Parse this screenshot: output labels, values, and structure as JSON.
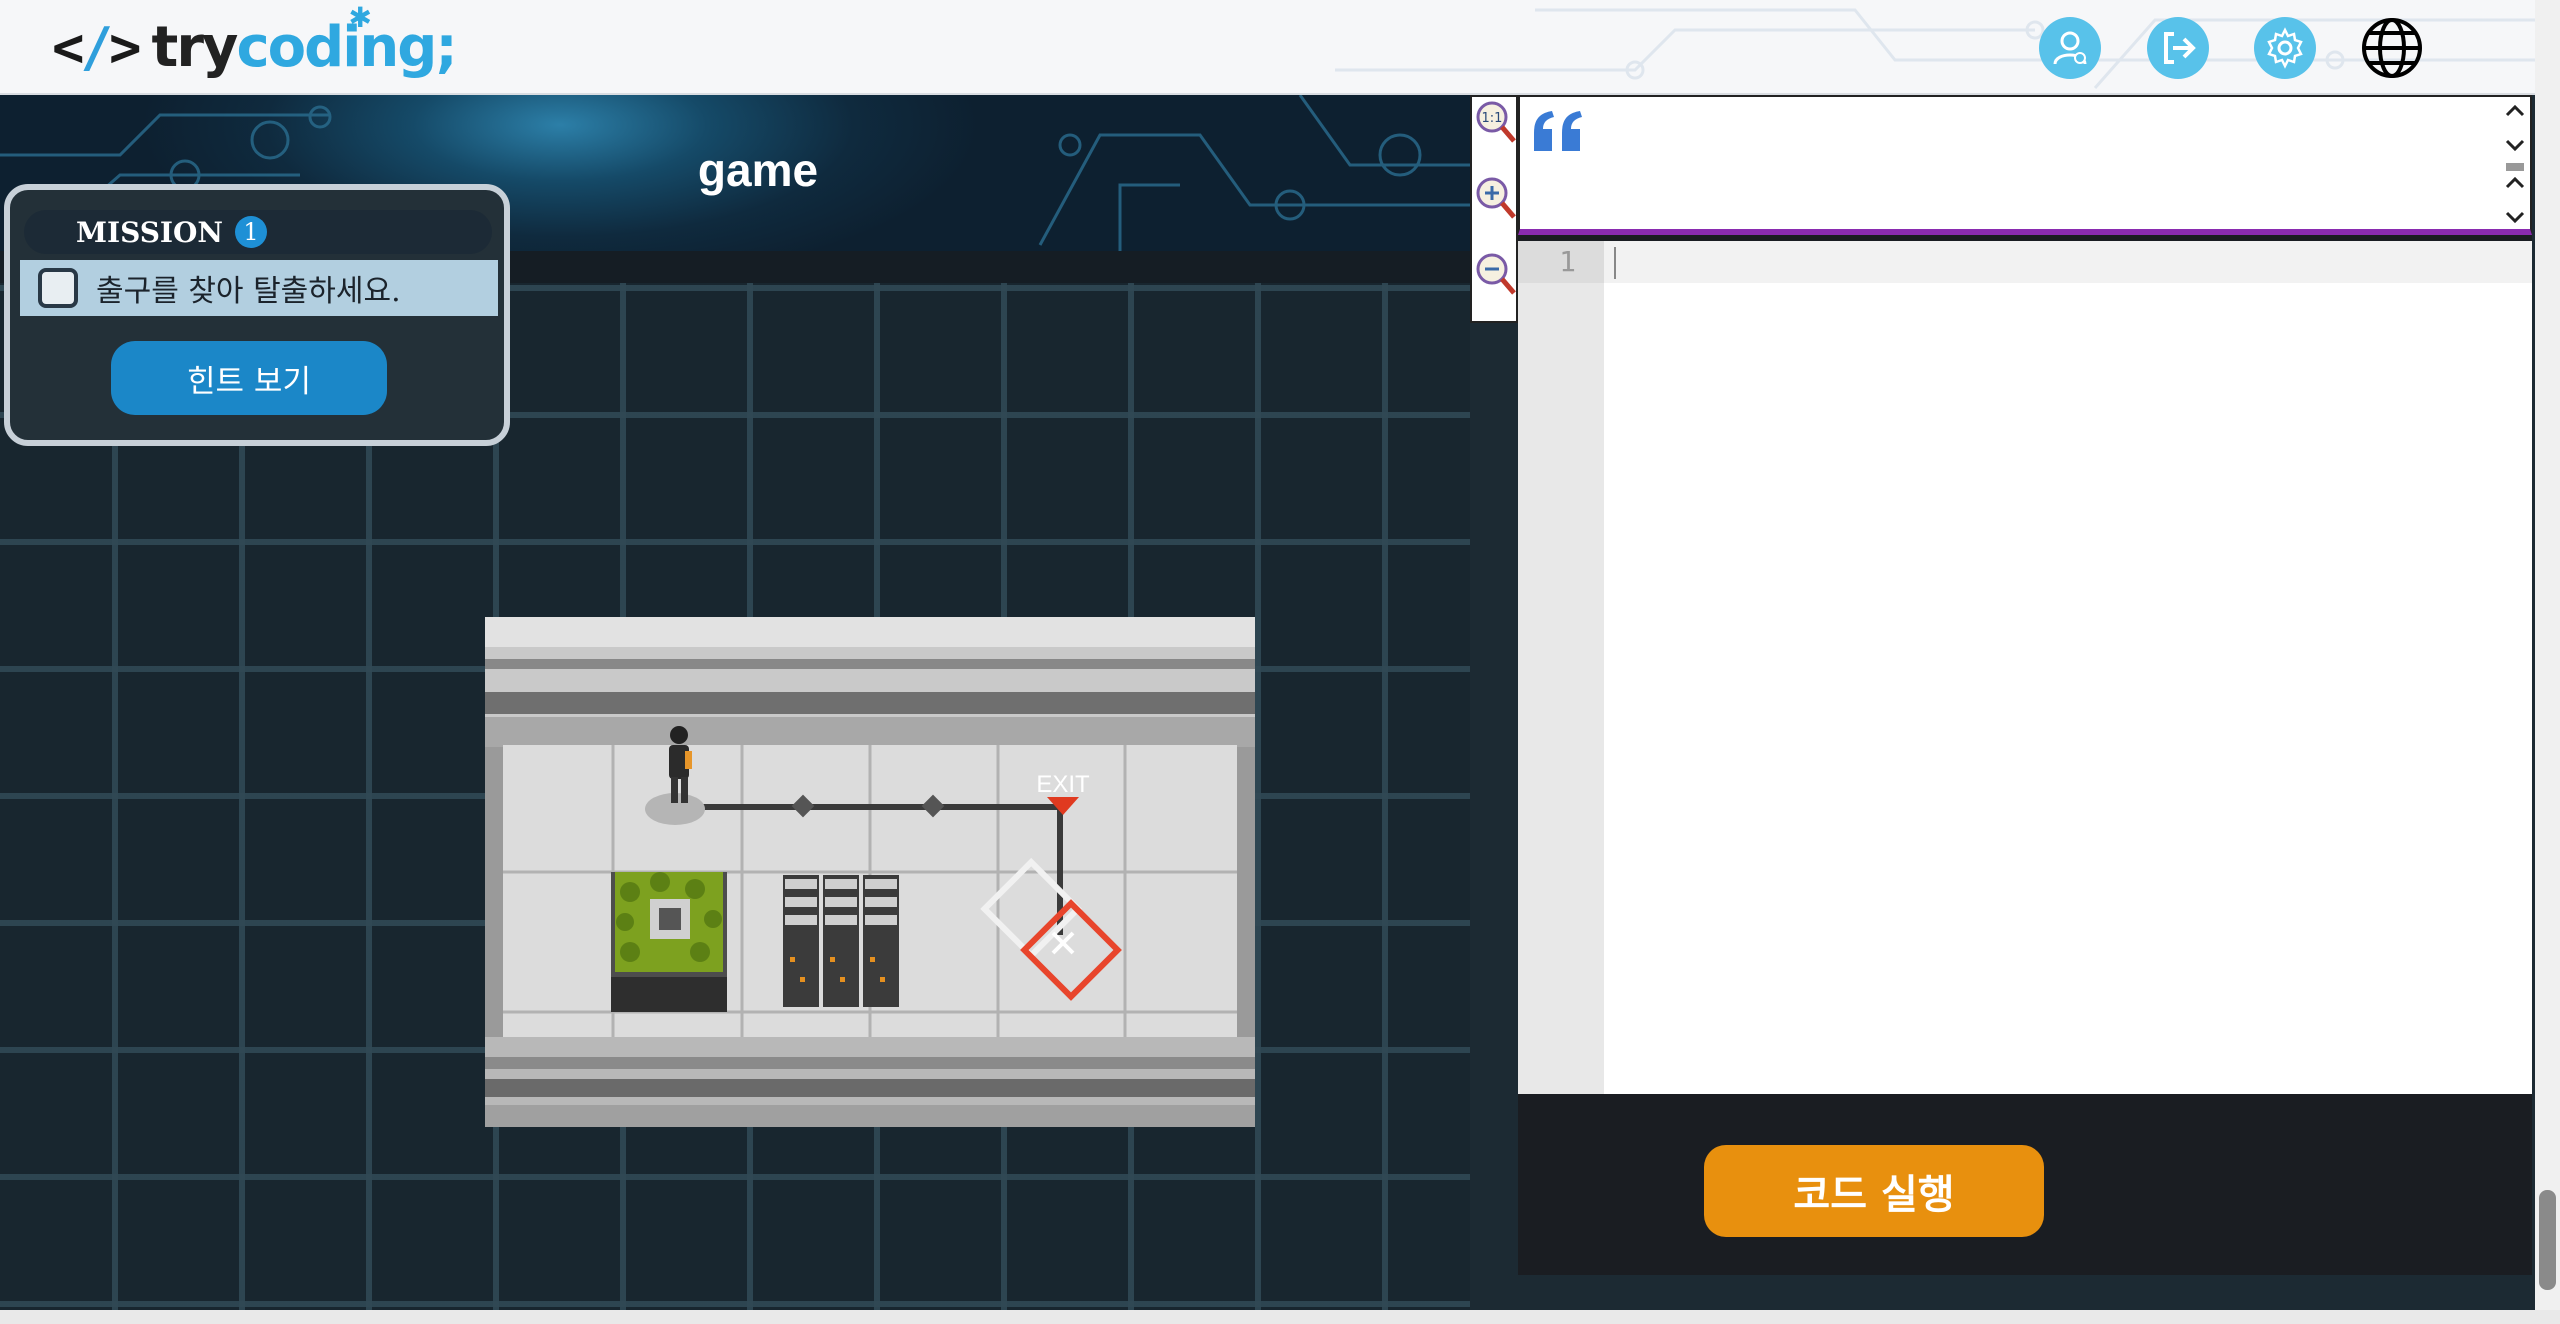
{
  "header": {
    "logo_brackets_left": "<",
    "logo_slash": "/",
    "logo_brackets_right": ">",
    "logo_try": "try",
    "logo_coding": "coding;",
    "icons": [
      "user-icon",
      "logout-icon",
      "gear-icon",
      "globe-icon"
    ]
  },
  "game": {
    "title": "game",
    "mission": {
      "label": "MISSION",
      "number": "1",
      "task": "출구를 찾아 탈출하세요.",
      "task_completed": false
    },
    "hint_button": "힌트 보기",
    "exit_label": "EXIT"
  },
  "zoom": {
    "reset_label": "1:1",
    "icons": [
      "zoom-reset-icon",
      "zoom-in-icon",
      "zoom-out-icon"
    ]
  },
  "editor": {
    "line_numbers": [
      "1"
    ],
    "code": "",
    "run_button": "코드 실행"
  },
  "colors": {
    "accent_blue": "#2fa8e0",
    "run_orange": "#e8900e",
    "editor_divider": "#8a2bb0",
    "hint_blue": "#1b87c8"
  }
}
